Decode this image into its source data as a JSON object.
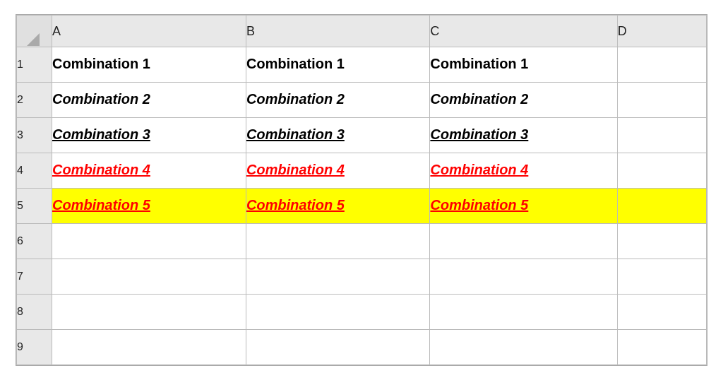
{
  "spreadsheet": {
    "columns": [
      "A",
      "B",
      "C",
      "D"
    ],
    "rows": [
      {
        "rowNum": "1",
        "cells": [
          {
            "text": "Combination 1",
            "style": "style-normal"
          },
          {
            "text": "Combination 1",
            "style": "style-normal"
          },
          {
            "text": "Combination 1",
            "style": "style-normal"
          }
        ],
        "highlight": false
      },
      {
        "rowNum": "2",
        "cells": [
          {
            "text": "Combination 2",
            "style": "style-italic-bold"
          },
          {
            "text": "Combination 2",
            "style": "style-italic-bold"
          },
          {
            "text": "Combination 2",
            "style": "style-italic-bold"
          }
        ],
        "highlight": false
      },
      {
        "rowNum": "3",
        "cells": [
          {
            "text": "Combination 3",
            "style": "style-underline-bold"
          },
          {
            "text": "Combination 3",
            "style": "style-underline-bold"
          },
          {
            "text": "Combination 3",
            "style": "style-underline-bold"
          }
        ],
        "highlight": false
      },
      {
        "rowNum": "4",
        "cells": [
          {
            "text": "Combination 4",
            "style": "style-red-underline"
          },
          {
            "text": "Combination 4",
            "style": "style-red-underline"
          },
          {
            "text": "Combination 4",
            "style": "style-red-underline"
          }
        ],
        "highlight": false
      },
      {
        "rowNum": "5",
        "cells": [
          {
            "text": "Combination 5",
            "style": "style-red-underline"
          },
          {
            "text": "Combination 5",
            "style": "style-red-underline"
          },
          {
            "text": "Combination 5",
            "style": "style-red-underline"
          }
        ],
        "highlight": true
      },
      {
        "rowNum": "6",
        "cells": [],
        "highlight": false,
        "empty": true
      },
      {
        "rowNum": "7",
        "cells": [],
        "highlight": false,
        "empty": true
      },
      {
        "rowNum": "8",
        "cells": [],
        "highlight": false,
        "empty": true
      },
      {
        "rowNum": "9",
        "cells": [],
        "highlight": false,
        "empty": true
      }
    ]
  }
}
